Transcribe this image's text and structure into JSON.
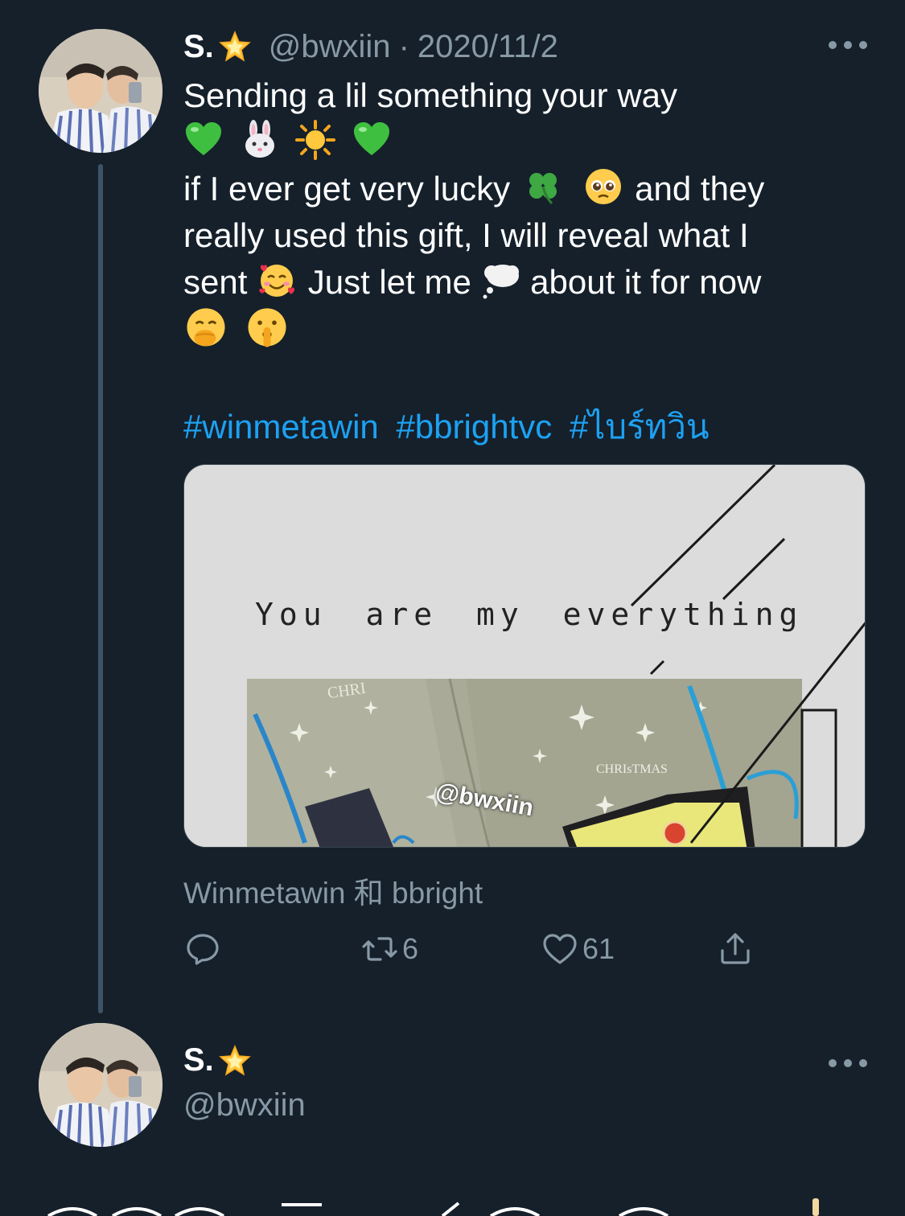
{
  "tweet": {
    "author_name": "S.",
    "author_emoji": "glowing-star",
    "handle": "@bwxiin",
    "separator": "·",
    "date": "2020/11/2",
    "lines": [
      "Sending a lil something your way",
      "",
      "if I ever get very lucky ",
      "really used this gift, I will reveal what I",
      "sent ",
      ""
    ],
    "line3_tail": "and they",
    "line5_mid": "Just let me ",
    "line5_tail": " about it for now",
    "emoji_row": [
      "green-heart",
      "rabbit-face",
      "sun",
      "green-heart"
    ],
    "hashtags": [
      "#winmetawin",
      "#bbrightvc",
      "#ไบร์ทวิน"
    ],
    "media_text": "You are my everything",
    "media_watermark": "@bwxiin",
    "media_labels": {
      "bag_left": "CHRI",
      "bag_right": "CHRIsTMAS"
    },
    "tagged_users": "Winmetawin 和 bbright",
    "retweets": "6",
    "likes": "61"
  },
  "tweet2": {
    "author_name": "S.",
    "handle": "@bwxiin"
  },
  "icons": {
    "reply": "reply-icon",
    "retweet": "retweet-icon",
    "like": "heart-icon",
    "share": "share-icon",
    "more": "more-icon"
  },
  "colors": {
    "background": "#15202b",
    "muted": "#8899a6",
    "link": "#1da1f2"
  }
}
